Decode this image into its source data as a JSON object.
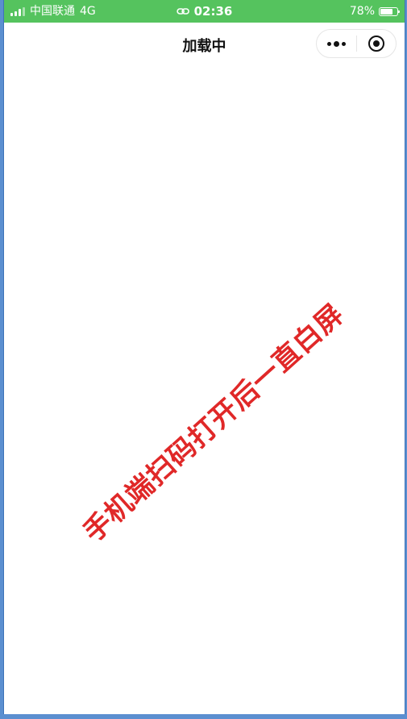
{
  "status_bar": {
    "carrier": "中国联通",
    "network": "4G",
    "time": "02:36",
    "battery_percent_text": "78%",
    "battery_level": 0.78,
    "background_color": "#55c35e",
    "signal_icon": "signal-bars-icon",
    "link_icon": "link-icon",
    "battery_icon": "battery-icon"
  },
  "nav_bar": {
    "title": "加载中",
    "more_icon": "more-dots-icon",
    "close_icon": "target-circle-icon"
  },
  "content": {
    "annotation_text": "手机端扫码打开后一直白屏",
    "annotation_color": "#e02828"
  }
}
